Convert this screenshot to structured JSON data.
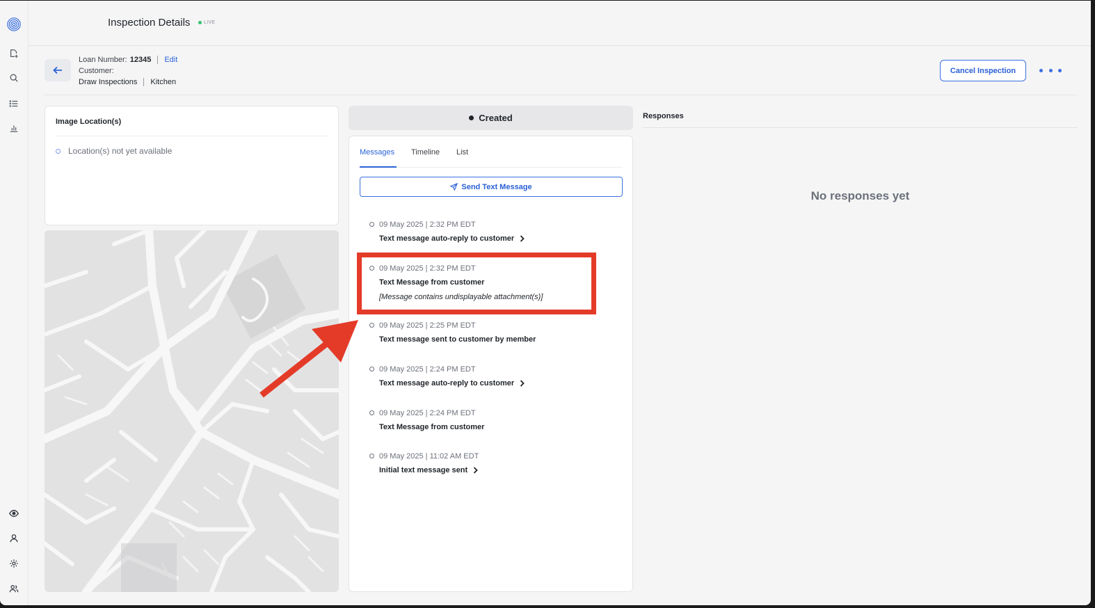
{
  "header": {
    "title": "Inspection Details",
    "live_badge": "LIVE"
  },
  "sidebar": {
    "items": [
      {
        "name": "logo-icon"
      },
      {
        "name": "new-inspection-icon"
      },
      {
        "name": "search-icon"
      },
      {
        "name": "list-icon"
      },
      {
        "name": "analytics-icon"
      },
      {
        "name": "eye-icon"
      },
      {
        "name": "user-icon"
      },
      {
        "name": "gear-icon"
      },
      {
        "name": "team-icon"
      }
    ]
  },
  "info": {
    "loan_label": "Loan Number:",
    "loan_value": "12345",
    "edit_label": "Edit",
    "customer_label": "Customer:",
    "category": "Draw Inspections",
    "area": "Kitchen"
  },
  "actions": {
    "cancel_label": "Cancel Inspection"
  },
  "location": {
    "title": "Image Location(s)",
    "empty_text": "Location(s) not yet available"
  },
  "status": {
    "label": "Created"
  },
  "tabs": [
    {
      "label": "Messages",
      "active": true
    },
    {
      "label": "Timeline",
      "active": false
    },
    {
      "label": "List",
      "active": false
    }
  ],
  "send_button": {
    "label": "Send Text Message"
  },
  "messages": [
    {
      "time": "09 May 2025 | 2:32 PM EDT",
      "title": "Text message auto-reply to customer",
      "expandable": true
    },
    {
      "time": "09 May 2025 | 2:32 PM EDT",
      "title": "Text Message from customer",
      "note": "[Message contains undisplayable attachment(s)]",
      "expandable": false
    },
    {
      "time": "09 May 2025 | 2:25 PM EDT",
      "title": "Text message sent to customer by member",
      "expandable": false
    },
    {
      "time": "09 May 2025 | 2:24 PM EDT",
      "title": "Text message auto-reply to customer",
      "expandable": true
    },
    {
      "time": "09 May 2025 | 2:24 PM EDT",
      "title": "Text Message from customer",
      "expandable": false
    },
    {
      "time": "09 May 2025 | 11:02 AM EDT",
      "title": "Initial text message sent",
      "expandable": true
    }
  ],
  "responses": {
    "title": "Responses",
    "empty_text": "No responses yet"
  },
  "colors": {
    "accent": "#2a63d8",
    "live": "#31c46c",
    "annotation": "#e43b29"
  }
}
